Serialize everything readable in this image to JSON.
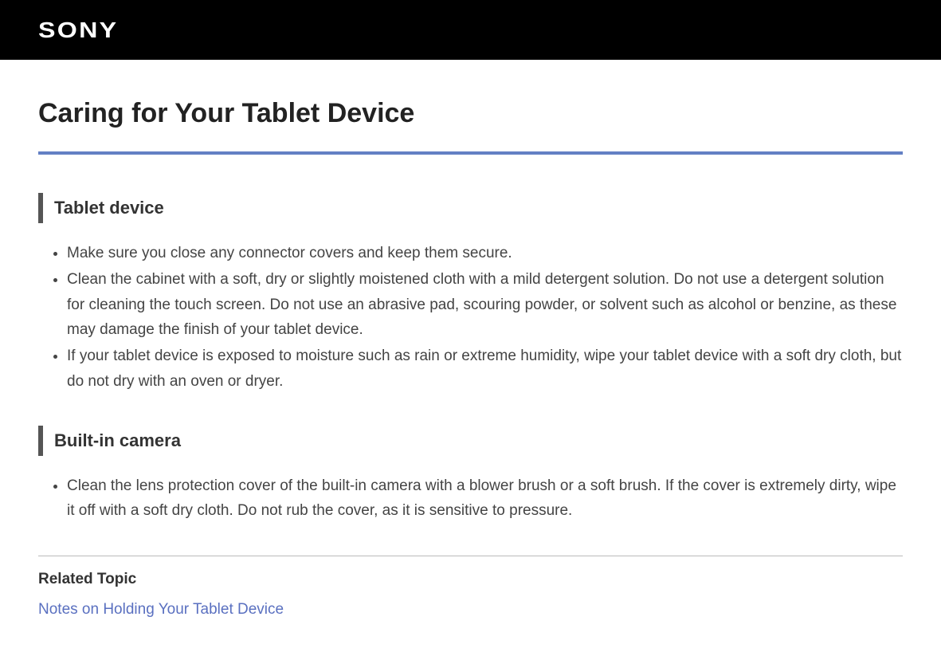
{
  "brand": "SONY",
  "page_title": "Caring for Your Tablet Device",
  "sections": [
    {
      "heading": "Tablet device",
      "items": [
        "Make sure you close any connector covers and keep them secure.",
        "Clean the cabinet with a soft, dry or slightly moistened cloth with a mild detergent solution. Do not use a detergent solution for cleaning the touch screen. Do not use an abrasive pad, scouring powder, or solvent such as alcohol or benzine, as these may damage the finish of your tablet device.",
        "If your tablet device is exposed to moisture such as rain or extreme humidity, wipe your tablet device with a soft dry cloth, but do not dry with an oven or dryer."
      ]
    },
    {
      "heading": "Built-in camera",
      "items": [
        "Clean the lens protection cover of the built-in camera with a blower brush or a soft brush. If the cover is extremely dirty, wipe it off with a soft dry cloth. Do not rub the cover, as it is sensitive to pressure."
      ]
    }
  ],
  "related": {
    "heading": "Related Topic",
    "links": [
      "Notes on Holding Your Tablet Device"
    ]
  }
}
